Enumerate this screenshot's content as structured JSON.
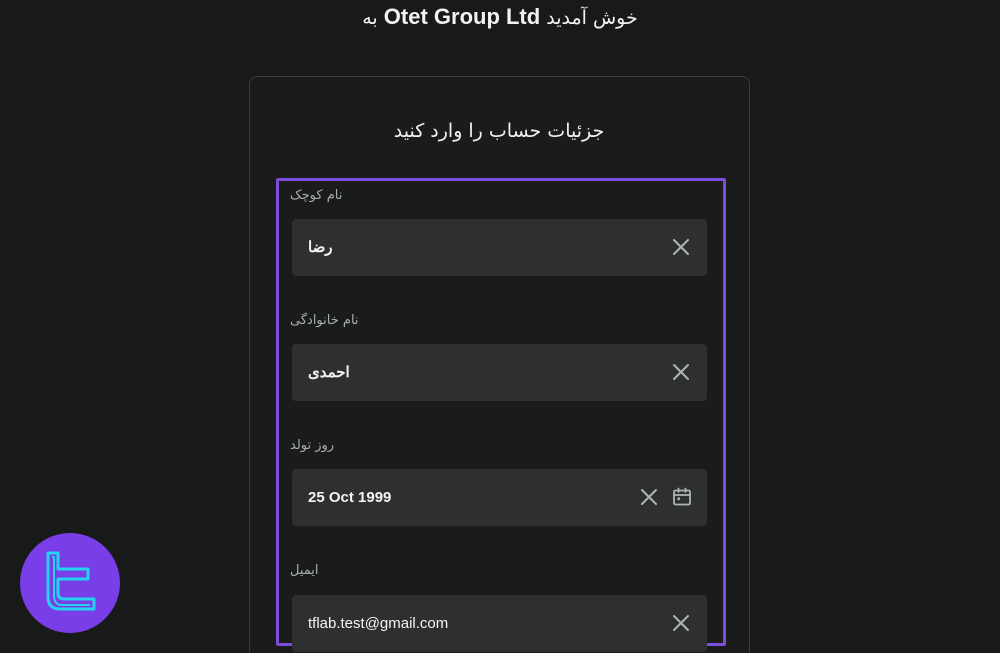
{
  "header": {
    "welcome_prefix": "خوش آمدید",
    "brand": "Otet Group Ltd",
    "welcome_suffix": "به"
  },
  "form": {
    "title": "جزئیات حساب را وارد کنید",
    "fields": [
      {
        "label": "نام کوچک",
        "value": "رضا",
        "icons": [
          "clear-icon"
        ]
      },
      {
        "label": "نام خانوادگی",
        "value": "احمدی",
        "icons": [
          "clear-icon"
        ]
      },
      {
        "label": "روز تولد",
        "value": "25 Oct 1999",
        "icons": [
          "clear-icon",
          "calendar-icon"
        ]
      },
      {
        "label": "ایمیل",
        "value": "tflab.test@gmail.com",
        "icons": [
          "clear-icon"
        ]
      }
    ]
  },
  "colors": {
    "background": "#181a19",
    "field_background": "#2d302f",
    "highlight_border": "#7b4ddb",
    "logo_background": "#7a3ee8",
    "logo_glyph": "#23d3f0"
  }
}
